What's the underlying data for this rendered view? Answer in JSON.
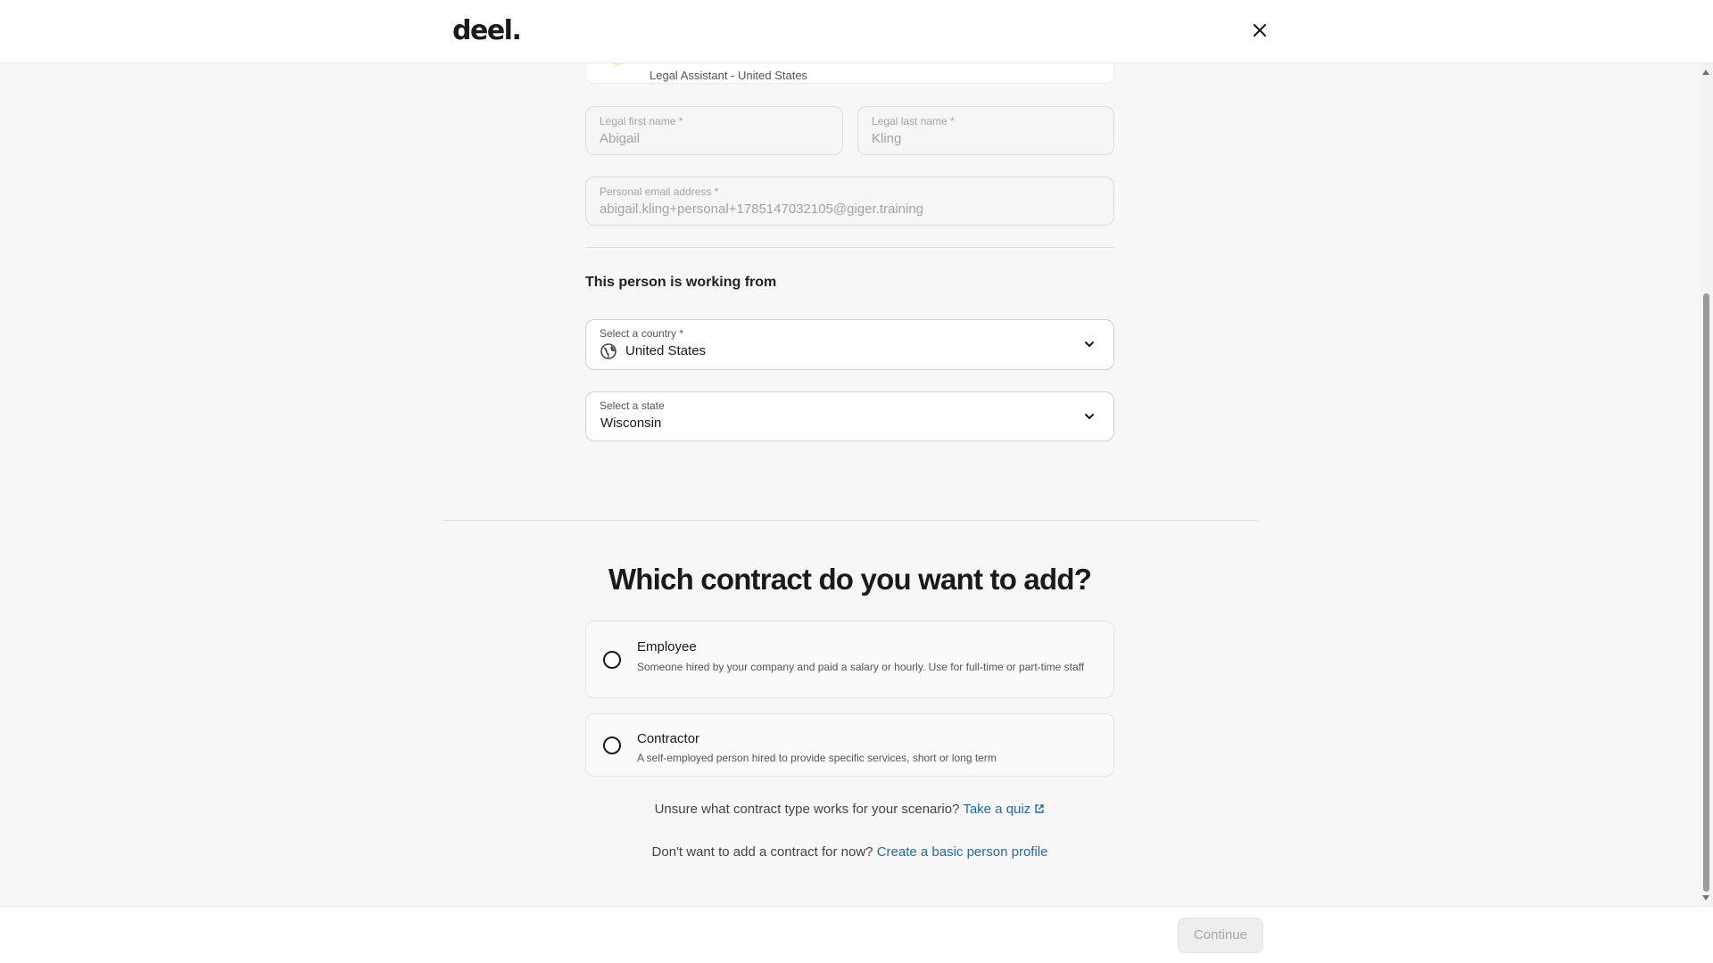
{
  "header": {
    "logo": "deel.",
    "close_icon": "close-icon"
  },
  "person": {
    "subtitle": "Legal Assistant - United States"
  },
  "form": {
    "first_name": {
      "label": "Legal first name *",
      "value": "Abigail"
    },
    "last_name": {
      "label": "Legal last name *",
      "value": "Kling"
    },
    "email": {
      "label": "Personal email address *",
      "value": "abigail.kling+personal+1785147032105@giger.training"
    }
  },
  "location": {
    "title": "This person is working from",
    "country": {
      "label": "Select a country *",
      "value": "United States",
      "icon": "globe-icon"
    },
    "state": {
      "label": "Select a state",
      "value": "Wisconsin"
    }
  },
  "contract": {
    "title": "Which contract do you want to add?",
    "options": [
      {
        "title": "Employee",
        "description": "Someone hired by your company and paid a salary or hourly. Use for full-time or part-time staff"
      },
      {
        "title": "Contractor",
        "description": "A self-employed person hired to provide specific services, short or long term"
      }
    ],
    "quiz_prompt": "Unsure what contract type works for your scenario?",
    "quiz_link": "Take a quiz",
    "profile_prompt": "Don't want to add a contract for now?",
    "profile_link": "Create a basic person profile"
  },
  "footer": {
    "continue_label": "Continue"
  },
  "colors": {
    "link": "#1f6ab5",
    "avatar": "#ffe79a"
  }
}
